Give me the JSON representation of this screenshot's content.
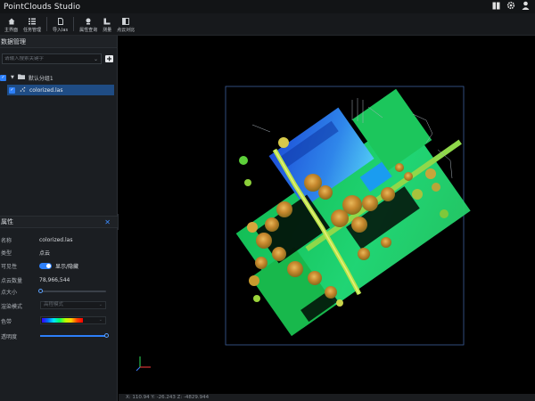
{
  "app": {
    "title": "PointClouds Studio"
  },
  "toolbar": {
    "items": [
      {
        "label": "主界面",
        "icon": "home-icon"
      },
      {
        "label": "任务管理",
        "icon": "list-icon"
      },
      {
        "label": "导入las",
        "icon": "file-import-icon"
      },
      {
        "label": "属性查询",
        "icon": "query-icon"
      },
      {
        "label": "测量",
        "icon": "ruler-icon"
      },
      {
        "label": "点云对比",
        "icon": "compare-icon"
      }
    ]
  },
  "data_panel": {
    "title": "数据管理",
    "search_placeholder": "请输入搜索关键字",
    "group_label": "默认分组1",
    "file_label": "colorized.las"
  },
  "properties": {
    "title": "属性",
    "rows": {
      "name": {
        "key": "名称",
        "value": "colorized.las"
      },
      "type": {
        "key": "类型",
        "value": "点云"
      },
      "visible": {
        "key": "可见性",
        "value": "显示/隐藏"
      },
      "count": {
        "key": "点云数量",
        "value": "78,966,544"
      },
      "point_size": {
        "key": "点大小"
      },
      "render_mode": {
        "key": "渲染模式",
        "value": "高程模式"
      },
      "color_ramp": {
        "key": "色带"
      },
      "opacity": {
        "key": "透明度"
      }
    },
    "point_size_level": 0.0,
    "opacity_level": 1.0
  },
  "status": {
    "coords": "X: 110.94  Y: -26.243  Z: -4829.944"
  },
  "colors": {
    "accent": "#2d7ff9",
    "panel_bg": "#1b1e22",
    "viewport_bg": "#000000"
  }
}
